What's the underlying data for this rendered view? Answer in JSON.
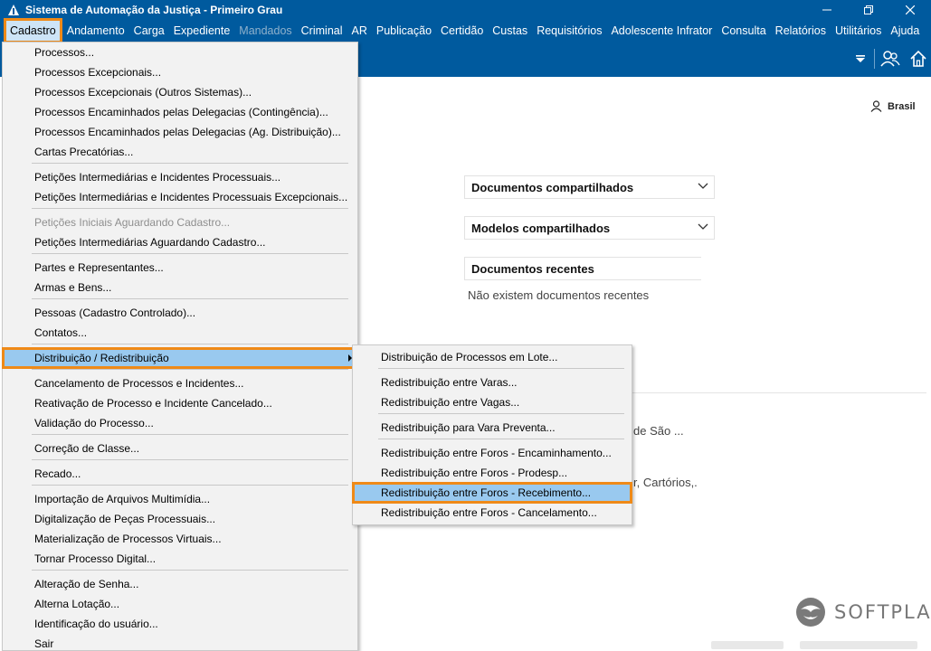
{
  "window": {
    "title": "Sistema de Automação da Justiça - Primeiro Grau"
  },
  "menubar": [
    {
      "label": "Cadastro",
      "state": "active"
    },
    {
      "label": "Andamento",
      "state": "normal"
    },
    {
      "label": "Carga",
      "state": "normal"
    },
    {
      "label": "Expediente",
      "state": "normal"
    },
    {
      "label": "Mandados",
      "state": "disabled"
    },
    {
      "label": "Criminal",
      "state": "normal"
    },
    {
      "label": "AR",
      "state": "normal"
    },
    {
      "label": "Publicação",
      "state": "normal"
    },
    {
      "label": "Certidão",
      "state": "normal"
    },
    {
      "label": "Custas",
      "state": "normal"
    },
    {
      "label": "Requisitórios",
      "state": "normal"
    },
    {
      "label": "Adolescente Infrator",
      "state": "normal"
    },
    {
      "label": "Consulta",
      "state": "normal"
    },
    {
      "label": "Relatórios",
      "state": "normal"
    },
    {
      "label": "Utilitários",
      "state": "normal"
    },
    {
      "label": "Ajuda",
      "state": "normal"
    }
  ],
  "user": {
    "name": "Brasil"
  },
  "panels": {
    "shared_docs": "Documentos compartilhados",
    "shared_models": "Modelos compartilhados",
    "recent_docs": "Documentos recentes",
    "no_recent": "Não existem documentos recentes",
    "partial_text_1": "de São ...",
    "partial_text_2": "r, Cartórios,."
  },
  "cadastro_menu": {
    "items": [
      {
        "label": "Processos...",
        "state": "normal"
      },
      {
        "label": "Processos Excepcionais...",
        "state": "normal"
      },
      {
        "label": "Processos Excepcionais (Outros Sistemas)...",
        "state": "normal"
      },
      {
        "label": "Processos Encaminhados pelas Delegacias (Contingência)...",
        "state": "normal"
      },
      {
        "label": "Processos Encaminhados pelas Delegacias (Ag. Distribuição)...",
        "state": "normal"
      },
      {
        "label": "Cartas Precatórias...",
        "state": "normal"
      },
      {
        "label": "Petições Intermediárias e Incidentes Processuais...",
        "state": "normal"
      },
      {
        "label": "Petições Intermediárias e Incidentes Processuais Excepcionais...",
        "state": "normal"
      },
      {
        "label": "Petições Iniciais Aguardando Cadastro...",
        "state": "disabled"
      },
      {
        "label": "Petições Intermediárias Aguardando Cadastro...",
        "state": "normal"
      },
      {
        "label": "Partes e Representantes...",
        "state": "normal"
      },
      {
        "label": "Armas e Bens...",
        "state": "normal"
      },
      {
        "label": "Pessoas (Cadastro Controlado)...",
        "state": "normal"
      },
      {
        "label": "Contatos...",
        "state": "normal"
      },
      {
        "label": "Distribuição / Redistribuição",
        "state": "highlighted"
      },
      {
        "label": "Cancelamento de Processos e Incidentes...",
        "state": "normal"
      },
      {
        "label": "Reativação de Processo e Incidente Cancelado...",
        "state": "normal"
      },
      {
        "label": "Validação do Processo...",
        "state": "normal"
      },
      {
        "label": "Correção de Classe...",
        "state": "normal"
      },
      {
        "label": "Recado...",
        "state": "normal"
      },
      {
        "label": "Importação de Arquivos Multimídia...",
        "state": "normal"
      },
      {
        "label": "Digitalização de Peças Processuais...",
        "state": "normal"
      },
      {
        "label": "Materialização de Processos Virtuais...",
        "state": "normal"
      },
      {
        "label": "Tornar Processo Digital...",
        "state": "normal"
      },
      {
        "label": "Alteração de Senha...",
        "state": "normal"
      },
      {
        "label": "Alterna Lotação...",
        "state": "normal"
      },
      {
        "label": "Identificação do usuário...",
        "state": "normal"
      },
      {
        "label": "Sair",
        "state": "normal"
      }
    ]
  },
  "distribuicao_submenu": {
    "items": [
      {
        "label": "Distribuição de Processos em Lote...",
        "state": "normal"
      },
      {
        "label": "Redistribuição entre Varas...",
        "state": "normal"
      },
      {
        "label": "Redistribuição entre Vagas...",
        "state": "normal"
      },
      {
        "label": "Redistribuição para Vara Preventa...",
        "state": "normal"
      },
      {
        "label": "Redistribuição entre Foros - Encaminhamento...",
        "state": "normal"
      },
      {
        "label": "Redistribuição entre Foros - Prodesp...",
        "state": "normal"
      },
      {
        "label": "Redistribuição entre Foros - Recebimento...",
        "state": "highlighted"
      },
      {
        "label": "Redistribuição entre Foros - Cancelamento...",
        "state": "normal"
      }
    ]
  },
  "branding": {
    "logo_text": "SOFTPLAN"
  },
  "icons": {
    "app": "scales-of-justice-icon",
    "minimize": "minimize-icon",
    "restore": "restore-icon",
    "close": "close-icon",
    "filter": "filter-icon",
    "users": "users-icon",
    "home": "home-icon",
    "user": "user-icon",
    "chevron": "chevron-down-icon",
    "submenu_arrow": "submenu-arrow-icon"
  },
  "colors": {
    "chrome": "#005a9e",
    "highlight": "#99c9ef",
    "annotation": "#ef8a18",
    "menu_bg": "#f2f2f2"
  }
}
